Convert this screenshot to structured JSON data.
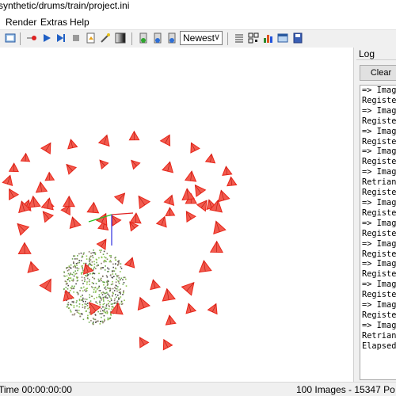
{
  "window": {
    "title": "synthetic/drums/train/project.ini"
  },
  "menu": [
    "Render",
    "Extras",
    "Help"
  ],
  "toolbar": {
    "mode_select": {
      "value": "Newest"
    },
    "icons": [
      "view-icon",
      "record-icon",
      "play-icon",
      "step-icon",
      "stop-icon",
      "reconstruct-icon",
      "wand-icon",
      "gradient-icon",
      "import-icon",
      "export-icon",
      "export2-icon",
      "grid-icon",
      "qr-icon",
      "bar-chart-icon",
      "window-icon",
      "save-icon"
    ]
  },
  "log_panel": {
    "title": "Log",
    "clear_label": "Clear",
    "lines": [
      "=> Imag",
      "Registe",
      "=> Imag",
      "Registe",
      "=> Imag",
      "Registe",
      "=> Imag",
      "Registe",
      "=> Imag",
      "Retrian",
      "Registe",
      "=> Imag",
      "Registe",
      "=> Imag",
      "Registe",
      "=> Imag",
      "Registe",
      "=> Imag",
      "Registe",
      "=> Imag",
      "Registe",
      "=> Imag",
      "Registe",
      "=> Imag",
      "Retrian",
      "Elapsed"
    ]
  },
  "status": {
    "left": "Time 00:00:00:00",
    "right": "100 Images - 15347 Po"
  },
  "colors": {
    "camera": "#e8261a",
    "camera_fill": "#f25a4e",
    "points": "#6aa84f",
    "axis_x": "#e02020",
    "axis_y": "#20c020",
    "axis_z": "#3030e0"
  }
}
